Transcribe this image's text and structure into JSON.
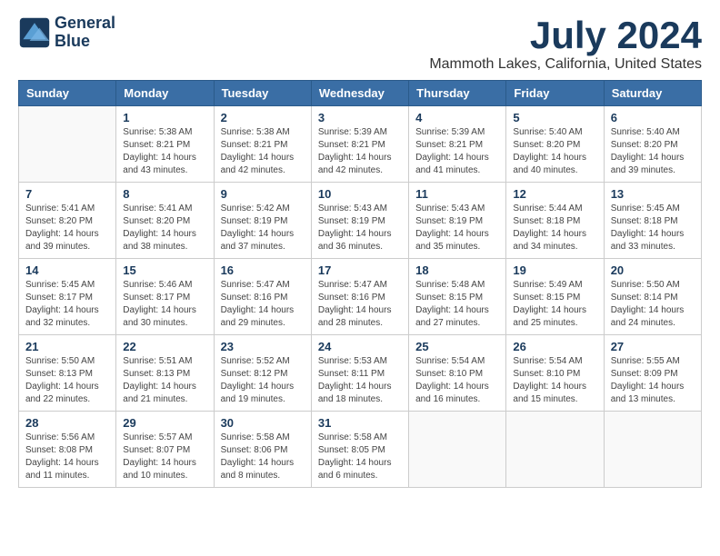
{
  "logo": {
    "line1": "General",
    "line2": "Blue"
  },
  "title": "July 2024",
  "subtitle": "Mammoth Lakes, California, United States",
  "headers": [
    "Sunday",
    "Monday",
    "Tuesday",
    "Wednesday",
    "Thursday",
    "Friday",
    "Saturday"
  ],
  "weeks": [
    [
      {
        "day": "",
        "sunrise": "",
        "sunset": "",
        "daylight": ""
      },
      {
        "day": "1",
        "sunrise": "Sunrise: 5:38 AM",
        "sunset": "Sunset: 8:21 PM",
        "daylight": "Daylight: 14 hours and 43 minutes."
      },
      {
        "day": "2",
        "sunrise": "Sunrise: 5:38 AM",
        "sunset": "Sunset: 8:21 PM",
        "daylight": "Daylight: 14 hours and 42 minutes."
      },
      {
        "day": "3",
        "sunrise": "Sunrise: 5:39 AM",
        "sunset": "Sunset: 8:21 PM",
        "daylight": "Daylight: 14 hours and 42 minutes."
      },
      {
        "day": "4",
        "sunrise": "Sunrise: 5:39 AM",
        "sunset": "Sunset: 8:21 PM",
        "daylight": "Daylight: 14 hours and 41 minutes."
      },
      {
        "day": "5",
        "sunrise": "Sunrise: 5:40 AM",
        "sunset": "Sunset: 8:20 PM",
        "daylight": "Daylight: 14 hours and 40 minutes."
      },
      {
        "day": "6",
        "sunrise": "Sunrise: 5:40 AM",
        "sunset": "Sunset: 8:20 PM",
        "daylight": "Daylight: 14 hours and 39 minutes."
      }
    ],
    [
      {
        "day": "7",
        "sunrise": "Sunrise: 5:41 AM",
        "sunset": "Sunset: 8:20 PM",
        "daylight": "Daylight: 14 hours and 39 minutes."
      },
      {
        "day": "8",
        "sunrise": "Sunrise: 5:41 AM",
        "sunset": "Sunset: 8:20 PM",
        "daylight": "Daylight: 14 hours and 38 minutes."
      },
      {
        "day": "9",
        "sunrise": "Sunrise: 5:42 AM",
        "sunset": "Sunset: 8:19 PM",
        "daylight": "Daylight: 14 hours and 37 minutes."
      },
      {
        "day": "10",
        "sunrise": "Sunrise: 5:43 AM",
        "sunset": "Sunset: 8:19 PM",
        "daylight": "Daylight: 14 hours and 36 minutes."
      },
      {
        "day": "11",
        "sunrise": "Sunrise: 5:43 AM",
        "sunset": "Sunset: 8:19 PM",
        "daylight": "Daylight: 14 hours and 35 minutes."
      },
      {
        "day": "12",
        "sunrise": "Sunrise: 5:44 AM",
        "sunset": "Sunset: 8:18 PM",
        "daylight": "Daylight: 14 hours and 34 minutes."
      },
      {
        "day": "13",
        "sunrise": "Sunrise: 5:45 AM",
        "sunset": "Sunset: 8:18 PM",
        "daylight": "Daylight: 14 hours and 33 minutes."
      }
    ],
    [
      {
        "day": "14",
        "sunrise": "Sunrise: 5:45 AM",
        "sunset": "Sunset: 8:17 PM",
        "daylight": "Daylight: 14 hours and 32 minutes."
      },
      {
        "day": "15",
        "sunrise": "Sunrise: 5:46 AM",
        "sunset": "Sunset: 8:17 PM",
        "daylight": "Daylight: 14 hours and 30 minutes."
      },
      {
        "day": "16",
        "sunrise": "Sunrise: 5:47 AM",
        "sunset": "Sunset: 8:16 PM",
        "daylight": "Daylight: 14 hours and 29 minutes."
      },
      {
        "day": "17",
        "sunrise": "Sunrise: 5:47 AM",
        "sunset": "Sunset: 8:16 PM",
        "daylight": "Daylight: 14 hours and 28 minutes."
      },
      {
        "day": "18",
        "sunrise": "Sunrise: 5:48 AM",
        "sunset": "Sunset: 8:15 PM",
        "daylight": "Daylight: 14 hours and 27 minutes."
      },
      {
        "day": "19",
        "sunrise": "Sunrise: 5:49 AM",
        "sunset": "Sunset: 8:15 PM",
        "daylight": "Daylight: 14 hours and 25 minutes."
      },
      {
        "day": "20",
        "sunrise": "Sunrise: 5:50 AM",
        "sunset": "Sunset: 8:14 PM",
        "daylight": "Daylight: 14 hours and 24 minutes."
      }
    ],
    [
      {
        "day": "21",
        "sunrise": "Sunrise: 5:50 AM",
        "sunset": "Sunset: 8:13 PM",
        "daylight": "Daylight: 14 hours and 22 minutes."
      },
      {
        "day": "22",
        "sunrise": "Sunrise: 5:51 AM",
        "sunset": "Sunset: 8:13 PM",
        "daylight": "Daylight: 14 hours and 21 minutes."
      },
      {
        "day": "23",
        "sunrise": "Sunrise: 5:52 AM",
        "sunset": "Sunset: 8:12 PM",
        "daylight": "Daylight: 14 hours and 19 minutes."
      },
      {
        "day": "24",
        "sunrise": "Sunrise: 5:53 AM",
        "sunset": "Sunset: 8:11 PM",
        "daylight": "Daylight: 14 hours and 18 minutes."
      },
      {
        "day": "25",
        "sunrise": "Sunrise: 5:54 AM",
        "sunset": "Sunset: 8:10 PM",
        "daylight": "Daylight: 14 hours and 16 minutes."
      },
      {
        "day": "26",
        "sunrise": "Sunrise: 5:54 AM",
        "sunset": "Sunset: 8:10 PM",
        "daylight": "Daylight: 14 hours and 15 minutes."
      },
      {
        "day": "27",
        "sunrise": "Sunrise: 5:55 AM",
        "sunset": "Sunset: 8:09 PM",
        "daylight": "Daylight: 14 hours and 13 minutes."
      }
    ],
    [
      {
        "day": "28",
        "sunrise": "Sunrise: 5:56 AM",
        "sunset": "Sunset: 8:08 PM",
        "daylight": "Daylight: 14 hours and 11 minutes."
      },
      {
        "day": "29",
        "sunrise": "Sunrise: 5:57 AM",
        "sunset": "Sunset: 8:07 PM",
        "daylight": "Daylight: 14 hours and 10 minutes."
      },
      {
        "day": "30",
        "sunrise": "Sunrise: 5:58 AM",
        "sunset": "Sunset: 8:06 PM",
        "daylight": "Daylight: 14 hours and 8 minutes."
      },
      {
        "day": "31",
        "sunrise": "Sunrise: 5:58 AM",
        "sunset": "Sunset: 8:05 PM",
        "daylight": "Daylight: 14 hours and 6 minutes."
      },
      {
        "day": "",
        "sunrise": "",
        "sunset": "",
        "daylight": ""
      },
      {
        "day": "",
        "sunrise": "",
        "sunset": "",
        "daylight": ""
      },
      {
        "day": "",
        "sunrise": "",
        "sunset": "",
        "daylight": ""
      }
    ]
  ]
}
